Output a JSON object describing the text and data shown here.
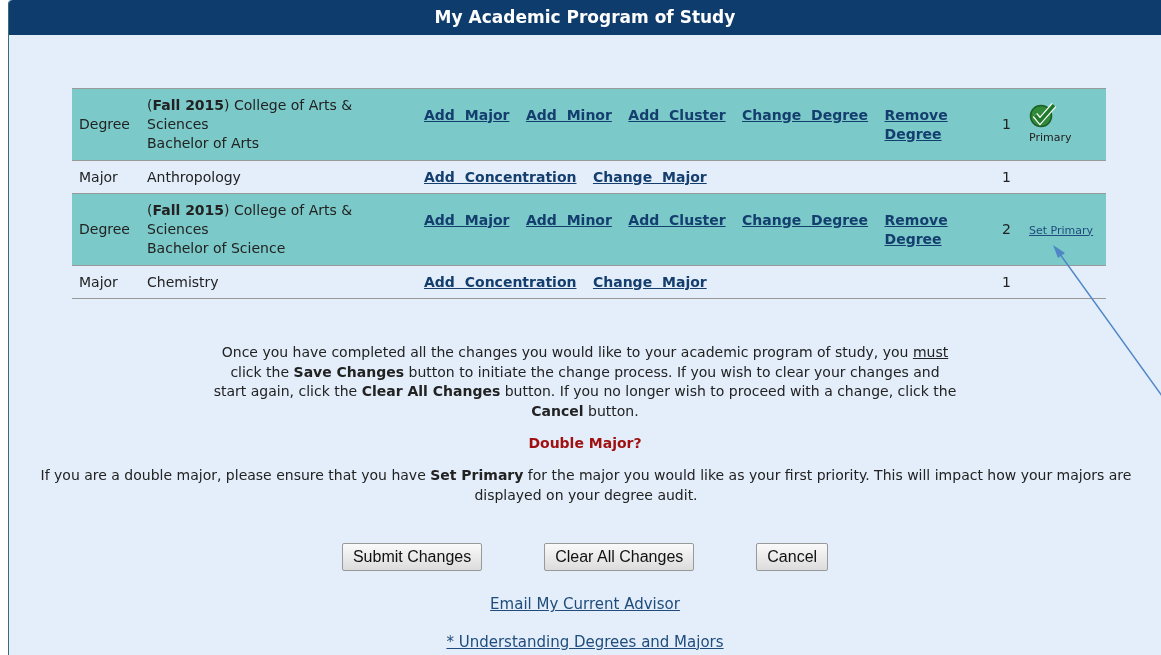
{
  "panel": {
    "title": "My Academic Program of Study"
  },
  "rows": [
    {
      "kind": "degree",
      "type": "Degree",
      "term": "(**Fall 2015**) College of Arts & Sciences",
      "program": "Bachelor of Arts",
      "actions": [
        "Add Major",
        "Add Minor",
        "Add Cluster",
        "Change Degree",
        "Remove Degree"
      ],
      "number": "1",
      "primary": true,
      "primary_label": "Primary"
    },
    {
      "kind": "major",
      "type": "Major",
      "term": "Anthropology",
      "actions": [
        "Add Concentration",
        "Change Major"
      ],
      "number": "1"
    },
    {
      "kind": "degree",
      "type": "Degree",
      "term": "(**Fall 2015**) College of Arts & Sciences",
      "program": "Bachelor of Science",
      "actions": [
        "Add Major",
        "Add Minor",
        "Add Cluster",
        "Change Degree",
        "Remove Degree"
      ],
      "number": "2",
      "primary": false,
      "primary_label": "Set Primary"
    },
    {
      "kind": "major",
      "type": "Major",
      "term": "Chemistry",
      "actions": [
        "Add Concentration",
        "Change Major"
      ],
      "number": "1"
    }
  ],
  "instructions": [
    {
      "text": "Once you have completed all the changes you would like to your academic program of study, you ",
      "underline": false
    },
    {
      "text": "must",
      "underline": true
    },
    {
      "text": " click the **Save Changes** button to initiate the change process.  If you wish to clear your changes and start again, click the **Clear All Changes** button.  If you no longer wish to proceed with a change, click the **Cancel** button.",
      "underline": false
    }
  ],
  "double_major": {
    "heading": "Double Major?",
    "text": "If you are a double major, please ensure that you have **Set Primary** for the major you would like as your first priority. This will impact how your majors are displayed on your degree audit."
  },
  "buttons": [
    "Submit Changes",
    "Clear All Changes",
    "Cancel"
  ],
  "links": [
    "Email My Current Advisor",
    "* Understanding Degrees and Majors"
  ]
}
